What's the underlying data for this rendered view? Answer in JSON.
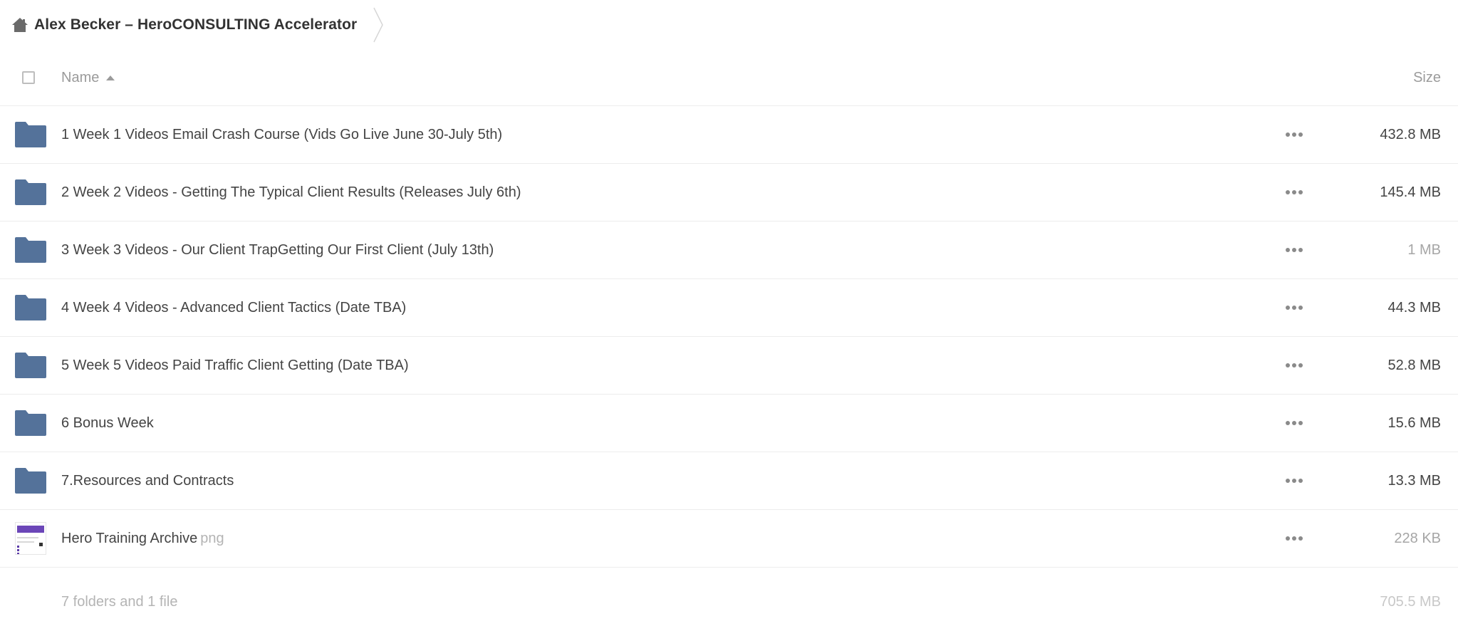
{
  "breadcrumb": {
    "home_icon": "home-icon",
    "current": "Alex Becker – HeroCONSULTING Accelerator"
  },
  "header": {
    "name": "Name",
    "size": "Size",
    "sort": "ascending"
  },
  "colors": {
    "folder": "#54729a",
    "text": "#444444",
    "muted": "#a6a6a6"
  },
  "items": [
    {
      "type": "folder",
      "name": "1 Week 1 Videos Email Crash Course (Vids Go Live June 30-July 5th)",
      "ext": "",
      "size": "432.8 MB",
      "dim": false
    },
    {
      "type": "folder",
      "name": "2 Week 2 Videos - Getting The Typical Client Results (Releases July 6th)",
      "ext": "",
      "size": "145.4 MB",
      "dim": false
    },
    {
      "type": "folder",
      "name": "3 Week 3 Videos - Our Client TrapGetting Our First Client (July 13th)",
      "ext": "",
      "size": "1 MB",
      "dim": true
    },
    {
      "type": "folder",
      "name": "4 Week 4 Videos - Advanced Client Tactics (Date TBA)",
      "ext": "",
      "size": "44.3 MB",
      "dim": false
    },
    {
      "type": "folder",
      "name": "5 Week 5 Videos Paid Traffic Client Getting (Date TBA)",
      "ext": "",
      "size": "52.8 MB",
      "dim": false
    },
    {
      "type": "folder",
      "name": "6 Bonus Week",
      "ext": "",
      "size": "15.6 MB",
      "dim": false
    },
    {
      "type": "folder",
      "name": "7.Resources and Contracts",
      "ext": "",
      "size": "13.3 MB",
      "dim": false
    },
    {
      "type": "file",
      "name": "Hero Training Archive",
      "ext": "png",
      "size": "228 KB",
      "dim": true
    }
  ],
  "summary": {
    "text": "7 folders and 1 file",
    "size": "705.5 MB"
  }
}
